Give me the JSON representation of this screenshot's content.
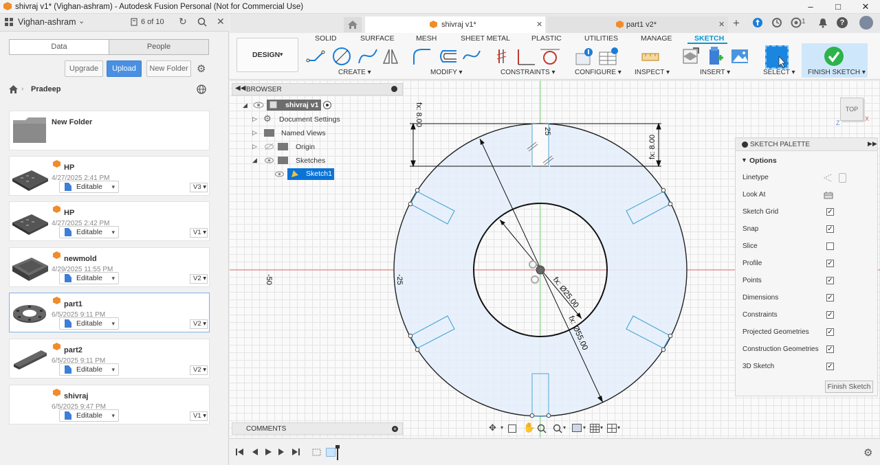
{
  "window": {
    "title": "shivraj v1* (Vighan-ashram) - Autodesk Fusion Personal (Not for Commercial Use)"
  },
  "project": {
    "name": "Vighan-ashram",
    "counter": "6 of 10"
  },
  "tabs": {
    "data": "Data",
    "people": "People"
  },
  "actions": {
    "upgrade": "Upgrade",
    "upload": "Upload",
    "new_folder": "New Folder"
  },
  "breadcrumb": {
    "current": "Pradeep"
  },
  "folder": {
    "name": "New Folder"
  },
  "files": [
    {
      "name": "HP",
      "date": "4/27/2025 2:41 PM",
      "status": "Editable",
      "version": "V3"
    },
    {
      "name": "HP",
      "date": "4/27/2025 2:42 PM",
      "status": "Editable",
      "version": "V1"
    },
    {
      "name": "newmold",
      "date": "4/29/2025 11:55 PM",
      "status": "Editable",
      "version": "V2"
    },
    {
      "name": "part1",
      "date": "6/5/2025 9:11 PM",
      "status": "Editable",
      "version": "V2"
    },
    {
      "name": "part2",
      "date": "6/5/2025 9:11 PM",
      "status": "Editable",
      "version": "V2"
    },
    {
      "name": "shivraj",
      "date": "6/5/2025 9:47 PM",
      "status": "Editable",
      "version": "V1"
    }
  ],
  "doc_tabs": [
    {
      "label": "shivraj v1*"
    },
    {
      "label": "part1 v2*"
    }
  ],
  "top_right": {
    "notify_count": "1"
  },
  "ribbon": {
    "design": "DESIGN",
    "tabs": [
      "SOLID",
      "SURFACE",
      "MESH",
      "SHEET METAL",
      "PLASTIC",
      "UTILITIES",
      "MANAGE",
      "SKETCH"
    ],
    "groups": [
      "CREATE",
      "MODIFY",
      "CONSTRAINTS",
      "CONFIGURE",
      "INSPECT",
      "INSERT",
      "SELECT"
    ],
    "finish": "FINISH SKETCH"
  },
  "browser": {
    "title": "BROWSER",
    "root": "shivraj v1",
    "items": [
      "Document Settings",
      "Named Views",
      "Origin",
      "Sketches"
    ],
    "sketch": "Sketch1"
  },
  "view_cube": {
    "label": "TOP"
  },
  "sketch_dims": {
    "d1": "fx: 8.00",
    "d2": "fx: 8.00",
    "d3": "fx: Ø25.00",
    "d4": "fx: Ø55.00",
    "t25top": "25",
    "t25left": "-25",
    "t50": "-50"
  },
  "palette": {
    "title": "SKETCH PALETTE",
    "section": "Options",
    "rows": [
      {
        "label": "Linetype",
        "state": "icon"
      },
      {
        "label": "Look At",
        "state": "icon"
      },
      {
        "label": "Sketch Grid",
        "state": "checked"
      },
      {
        "label": "Snap",
        "state": "checked"
      },
      {
        "label": "Slice",
        "state": "unchecked"
      },
      {
        "label": "Profile",
        "state": "checked"
      },
      {
        "label": "Points",
        "state": "checked"
      },
      {
        "label": "Dimensions",
        "state": "checked"
      },
      {
        "label": "Constraints",
        "state": "checked"
      },
      {
        "label": "Projected Geometries",
        "state": "checked"
      },
      {
        "label": "Construction Geometries",
        "state": "checked"
      },
      {
        "label": "3D Sketch",
        "state": "checked"
      }
    ],
    "finish": "Finish Sketch"
  },
  "comments": {
    "title": "COMMENTS"
  },
  "colors": {
    "accent": "#0696d7",
    "upload": "#4a90e2",
    "finish": "#2db34a",
    "profile": "#e4eefa",
    "selected": "#0a73d6"
  }
}
